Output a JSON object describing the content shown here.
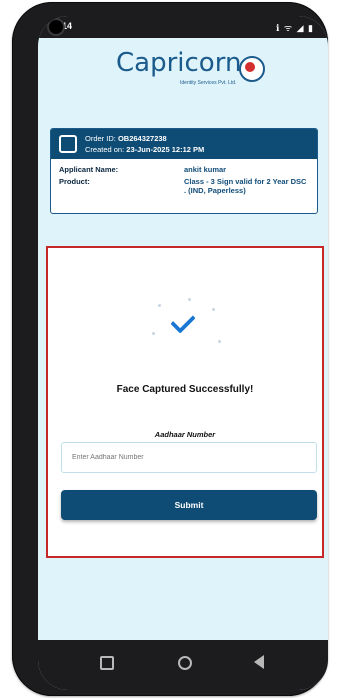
{
  "status": {
    "time": "2:14",
    "icons": "ℹ ᯤ ◢ ▮"
  },
  "brand": {
    "name": "Capricorn",
    "tagline": "Identity Services Pvt. Ltd."
  },
  "order": {
    "id_label": "Order ID:",
    "id_value": "OB264327238",
    "created_label": "Created on:",
    "created_value": "23-Jun-2025 12:12 PM"
  },
  "applicant": {
    "name_label": "Applicant Name:",
    "name_value": "ankit kumar",
    "product_label": "Product:",
    "product_value": "Class - 3 Sign valid for 2 Year DSC . (IND, Paperless)"
  },
  "capture": {
    "message": "Face Captured Successfully!",
    "aadhaar_label": "Aadhaar Number",
    "aadhaar_placeholder": "Enter Aadhaar Number",
    "aadhaar_value": "",
    "submit_label": "Submit"
  },
  "colors": {
    "primary": "#0f4c75",
    "panel_border": "#c62828",
    "background": "#dff3fb",
    "check": "#1976d2"
  },
  "icons": {
    "order": "receipt-icon",
    "success": "checkmark-icon",
    "nav_recent": "square-icon",
    "nav_home": "circle-icon",
    "nav_back": "triangle-back-icon"
  }
}
